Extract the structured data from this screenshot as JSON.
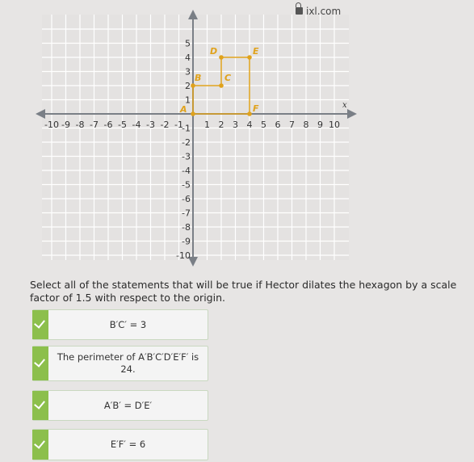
{
  "browser": {
    "url": "ixl.com",
    "lock_icon": "lock-icon"
  },
  "graph": {
    "x_axis_label": "x",
    "x_range": [
      -10,
      10
    ],
    "y_range": [
      -10,
      6
    ],
    "x_tick_labels": [
      "-10",
      "-9",
      "-8",
      "-7",
      "-6",
      "-5",
      "-4",
      "-3",
      "-2",
      "-1",
      "1",
      "2",
      "3",
      "4",
      "5",
      "6",
      "7",
      "8",
      "9",
      "10"
    ],
    "y_tick_labels": [
      "5",
      "4",
      "3",
      "2",
      "1",
      "-1",
      "-2",
      "-3",
      "-4",
      "-5",
      "-6",
      "-7",
      "-8",
      "-9",
      "-10"
    ],
    "point_color": "#e0a21c",
    "points": [
      {
        "label": "A",
        "x": 0,
        "y": 0
      },
      {
        "label": "B",
        "x": 0,
        "y": 2
      },
      {
        "label": "C",
        "x": 2,
        "y": 2
      },
      {
        "label": "D",
        "x": 2,
        "y": 4
      },
      {
        "label": "E",
        "x": 4,
        "y": 4
      },
      {
        "label": "F",
        "x": 4,
        "y": 0
      }
    ]
  },
  "question": {
    "prompt": "Select all of the statements that will be true if Hector dilates the hexagon by a scale factor of 1.5 with respect to the origin."
  },
  "answers": [
    {
      "text": "B′C′ = 3",
      "selected": true
    },
    {
      "text": "The perimeter of A′B′C′D′E′F′ is 24.",
      "selected": true
    },
    {
      "text": "A′B′ = D′E′",
      "selected": true
    },
    {
      "text": "E′F′ = 6",
      "selected": true
    }
  ],
  "colors": {
    "selected_accent": "#8cbf4c",
    "grid_line": "#ffffff",
    "axis": "#7a7f86"
  }
}
